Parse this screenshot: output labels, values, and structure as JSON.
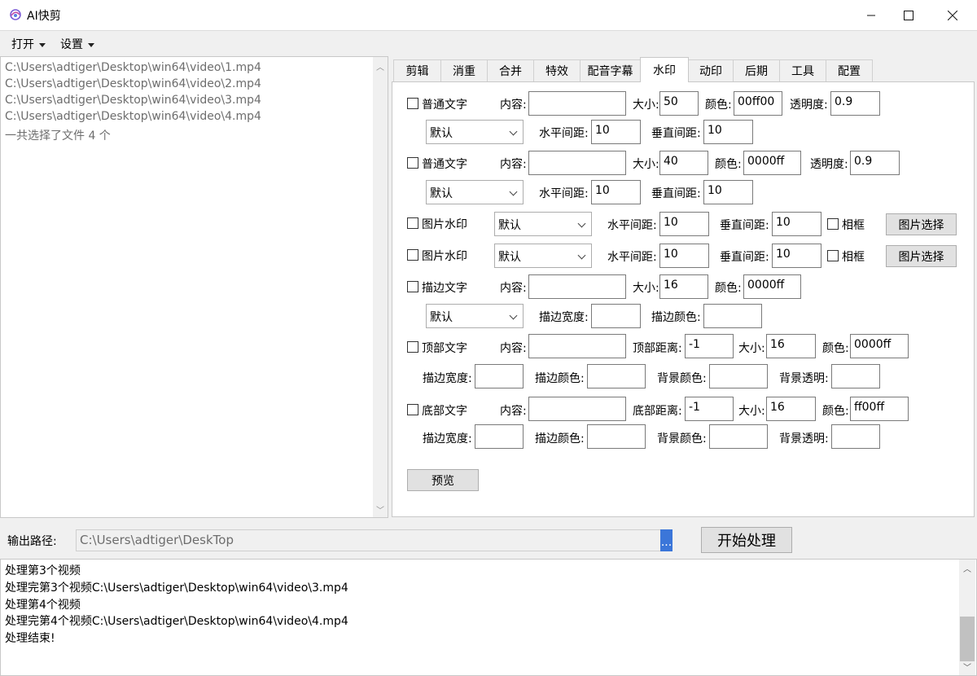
{
  "window": {
    "title": "AI快剪",
    "minimize": "—",
    "maximize": "☐",
    "close": "✕"
  },
  "menu": {
    "open": "打开",
    "settings": "设置"
  },
  "files": [
    "C:\\Users\\adtiger\\Desktop\\win64\\video\\1.mp4",
    "C:\\Users\\adtiger\\Desktop\\win64\\video\\2.mp4",
    "C:\\Users\\adtiger\\Desktop\\win64\\video\\3.mp4",
    "C:\\Users\\adtiger\\Desktop\\win64\\video\\4.mp4",
    "一共选择了文件 4 个"
  ],
  "tabs": [
    "剪辑",
    "消重",
    "合并",
    "特效",
    "配音字幕",
    "水印",
    "动印",
    "后期",
    "工具",
    "配置"
  ],
  "active_tab": "水印",
  "labels": {
    "content": "内容:",
    "size": "大小:",
    "color": "颜色:",
    "opacity": "透明度:",
    "h_spacing": "水平间距:",
    "v_spacing": "垂直间距:",
    "frame": "相框",
    "pick_image": "图片选择",
    "stroke_width": "描边宽度:",
    "stroke_color": "描边颜色:",
    "top_distance": "顶部距离:",
    "bottom_distance": "底部距离:",
    "bg_color": "背景颜色:",
    "bg_opacity": "背景透明:",
    "preview": "预览"
  },
  "watermark": {
    "text1": {
      "label": "普通文字",
      "content": "",
      "size": "50",
      "color": "00ff00",
      "opacity": "0.9",
      "position": "默认",
      "h": "10",
      "v": "10"
    },
    "text2": {
      "label": "普通文字",
      "content": "",
      "size": "40",
      "color": "0000ff",
      "opacity": "0.9",
      "position": "默认",
      "h": "10",
      "v": "10"
    },
    "image1": {
      "label": "图片水印",
      "position": "默认",
      "h": "10",
      "v": "10"
    },
    "image2": {
      "label": "图片水印",
      "position": "默认",
      "h": "10",
      "v": "10"
    },
    "stroke": {
      "label": "描边文字",
      "content": "",
      "size": "16",
      "color": "0000ff",
      "position": "默认",
      "stroke_width": "",
      "stroke_color": ""
    },
    "top": {
      "label": "顶部文字",
      "content": "",
      "distance": "-1",
      "size": "16",
      "color": "0000ff",
      "stroke_width": "",
      "stroke_color": "",
      "bg_color": "",
      "bg_opacity": ""
    },
    "bottom": {
      "label": "底部文字",
      "content": "",
      "distance": "-1",
      "size": "16",
      "color": "ff00ff",
      "stroke_width": "",
      "stroke_color": "",
      "bg_color": "",
      "bg_opacity": ""
    }
  },
  "output": {
    "label": "输出路径:",
    "path": "C:\\Users\\adtiger\\DeskTop",
    "browse": "...",
    "start": "开始处理"
  },
  "log": [
    "处理第3个视频",
    "处理完第3个视频C:\\Users\\adtiger\\Desktop\\win64\\video\\3.mp4",
    "处理第4个视频",
    "处理完第4个视频C:\\Users\\adtiger\\Desktop\\win64\\video\\4.mp4",
    "处理结束!"
  ]
}
